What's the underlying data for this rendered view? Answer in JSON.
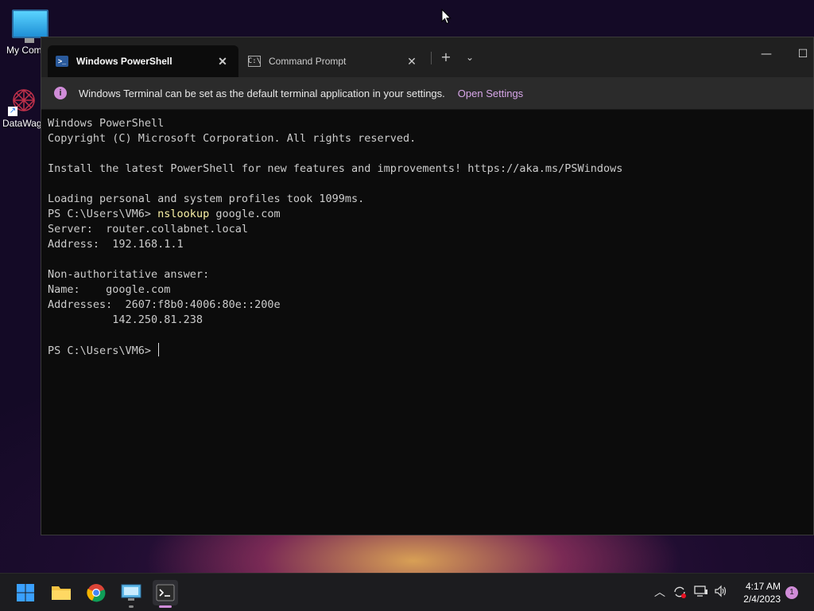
{
  "desktop": {
    "icons": [
      {
        "label": "My Comp"
      },
      {
        "label": "DataWag"
      }
    ]
  },
  "terminal": {
    "tabs": [
      {
        "label": "Windows PowerShell",
        "icon": "powershell-icon",
        "active": true
      },
      {
        "label": "Command Prompt",
        "icon": "command-prompt-icon",
        "active": false
      }
    ],
    "new_tab_glyph": "+",
    "dropdown_glyph": "⌄",
    "infobar": {
      "message": "Windows Terminal can be set as the default terminal application in your settings.",
      "link": "Open Settings",
      "accent": "#d08cd8"
    },
    "lines": [
      {
        "text": "Windows PowerShell"
      },
      {
        "text": "Copyright (C) Microsoft Corporation. All rights reserved."
      },
      {
        "text": ""
      },
      {
        "text": "Install the latest PowerShell for new features and improvements! https://aka.ms/PSWindows"
      },
      {
        "text": ""
      },
      {
        "text": "Loading personal and system profiles took 1099ms."
      },
      {
        "prompt": "PS C:\\Users\\VM6> ",
        "cmd": "nslookup",
        "args": " google.com"
      },
      {
        "text": "Server:  router.collabnet.local"
      },
      {
        "text": "Address:  192.168.1.1"
      },
      {
        "text": ""
      },
      {
        "text": "Non-authoritative answer:"
      },
      {
        "text": "Name:    google.com"
      },
      {
        "text": "Addresses:  2607:f8b0:4006:80e::200e"
      },
      {
        "text": "          142.250.81.238"
      },
      {
        "text": ""
      },
      {
        "prompt": "PS C:\\Users\\VM6> ",
        "caret": true
      }
    ]
  },
  "taskbar": {
    "apps": [
      {
        "name": "start-icon"
      },
      {
        "name": "file-explorer-icon"
      },
      {
        "name": "chrome-icon"
      },
      {
        "name": "remote-desktop-icon"
      },
      {
        "name": "terminal-icon"
      }
    ],
    "clock": {
      "time": "4:17 AM",
      "date": "2/4/2023"
    },
    "notifications": "1"
  }
}
